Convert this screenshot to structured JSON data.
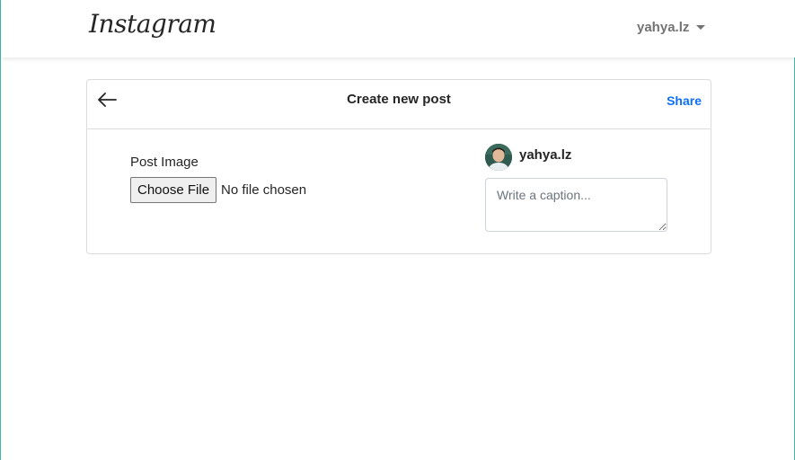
{
  "navbar": {
    "logo_text": "Instagram",
    "username": "yahya.lz"
  },
  "card": {
    "title": "Create new post",
    "share_label": "Share",
    "post_image_label": "Post Image",
    "choose_file_label": "Choose File",
    "file_status": "No file chosen",
    "author_name": "yahya.lz",
    "caption_placeholder": "Write a caption..."
  },
  "icons": {
    "back": "arrow-left-icon",
    "dropdown": "caret-down-icon",
    "avatar": "user-avatar"
  },
  "colors": {
    "accent": "#0d6efd",
    "muted_text": "#737373",
    "border": "#dcdcdc",
    "frame": "#3fb7a6"
  }
}
